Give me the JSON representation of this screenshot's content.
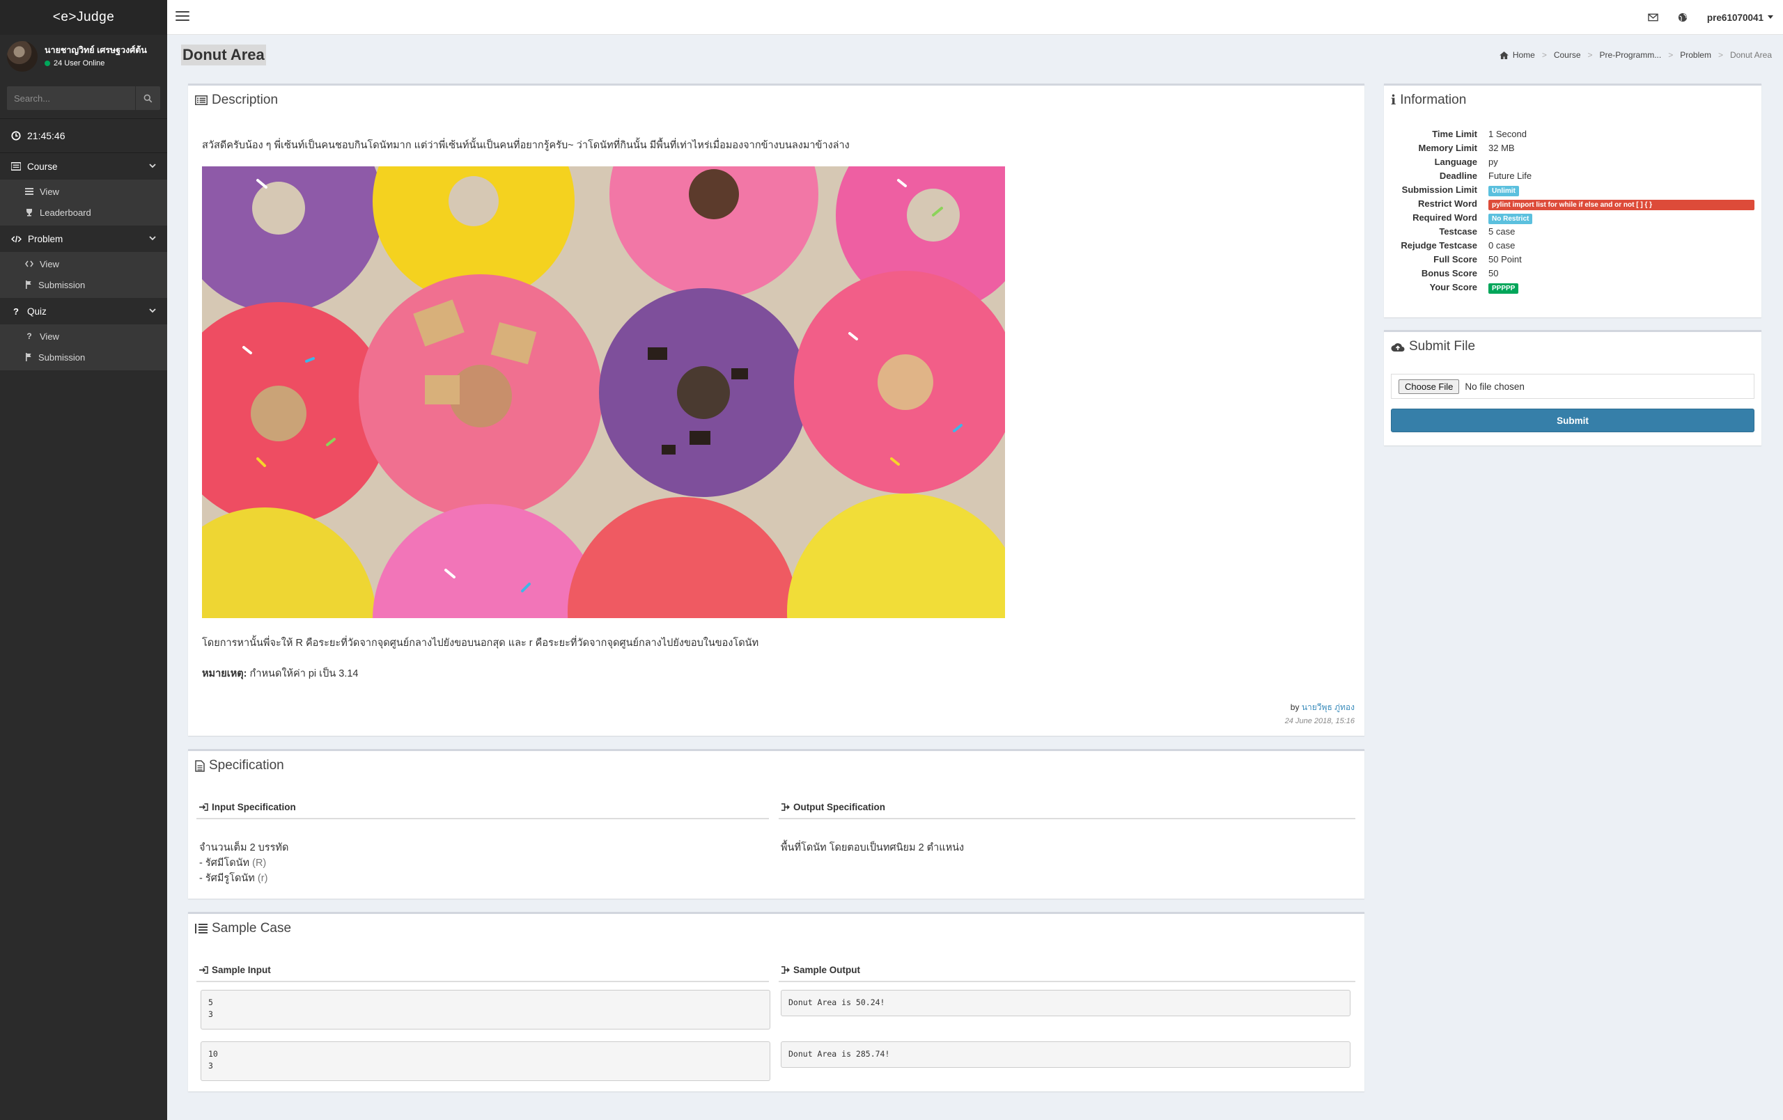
{
  "app": {
    "logo": "<e>Judge"
  },
  "user_panel": {
    "name": "นายชาญวิทย์ เศรษฐวงศ์ต้น",
    "status": "24 User Online"
  },
  "search": {
    "placeholder": "Search..."
  },
  "clock": {
    "time": "21:45:46"
  },
  "sidebar": {
    "course": {
      "label": "Course",
      "items": [
        "View",
        "Leaderboard"
      ]
    },
    "problem": {
      "label": "Problem",
      "items": [
        "View",
        "Submission"
      ]
    },
    "quiz": {
      "label": "Quiz",
      "items": [
        "View",
        "Submission"
      ]
    }
  },
  "topbar": {
    "username": "pre61070041"
  },
  "page": {
    "title": "Donut Area"
  },
  "breadcrumb": [
    "Home",
    "Course",
    "Pre-Programm...",
    "Problem",
    "Donut Area"
  ],
  "description": {
    "title": "Description",
    "intro": "สวัสดีครับน้อง ๆ พี่เซ้นท์เป็นคนชอบกินโดนัทมาก แต่ว่าพี่เซ้นท์นั้นเป็นคนที่อยากรู้ครับ~ ว่าโดนัทที่กินนั้น มีพื้นที่เท่าไหร่เมื่อมองจากข้างบนลงมาข้างล่าง",
    "body": "โดยการหานั้นพี่จะให้ R คือระยะที่วัดจากจุดศูนย์กลางไปยังขอบนอกสุด และ r คือระยะที่วัดจากจุดศูนย์กลางไปยังขอบในของโดนัท",
    "note_label": "หมายเหตุ:",
    "note_text": "กำหนดให้ค่า pi เป็น 3.14",
    "by_label": "by",
    "author": "นายวีพุธ ภู่ทอง",
    "date": "24 June 2018, 15:16"
  },
  "specification": {
    "title": "Specification",
    "input_label": "Input Specification",
    "output_label": "Output Specification",
    "input_line1": "จำนวนเต็ม 2 บรรทัด",
    "input_line2": "- รัศมีโดนัท",
    "input_line2_var": "(R)",
    "input_line3": "- รัศมีรูโดนัท",
    "input_line3_var": "(r)",
    "output_text": "พื้นที่โดนัท โดยตอบเป็นทศนิยม 2 ตำแหน่ง"
  },
  "samples": {
    "title": "Sample Case",
    "input_label": "Sample Input",
    "output_label": "Sample Output",
    "cases": [
      {
        "input": "5\n3",
        "output": "Donut Area is 50.24!"
      },
      {
        "input": "10\n3",
        "output": "Donut Area is 285.74!"
      }
    ]
  },
  "information": {
    "title": "Information",
    "rows": [
      {
        "key": "Time Limit",
        "value": "1 Second"
      },
      {
        "key": "Memory Limit",
        "value": "32 MB"
      },
      {
        "key": "Language",
        "value": "py"
      },
      {
        "key": "Deadline",
        "value": "Future Life"
      },
      {
        "key": "Submission Limit",
        "value": "Unlimit"
      },
      {
        "key": "Restrict Word",
        "value": "pylint import list for while if else and or not [ ] { }"
      },
      {
        "key": "Required Word",
        "value": "No Restrict"
      },
      {
        "key": "Testcase",
        "value": "5 case"
      },
      {
        "key": "Rejudge Testcase",
        "value": "0 case"
      },
      {
        "key": "Full Score",
        "value": "50 Point"
      },
      {
        "key": "Bonus Score",
        "value": "50"
      },
      {
        "key": "Your Score",
        "value": "PPPPP"
      }
    ]
  },
  "submit": {
    "title": "Submit File",
    "choose_label": "Choose File",
    "no_file": "No file chosen",
    "button": "Submit"
  },
  "colors": {
    "sidebar": "#2b2b2b",
    "primary": "#367fa9",
    "danger": "#dd4b39",
    "info": "#5bc0de",
    "success": "#00a65a"
  }
}
